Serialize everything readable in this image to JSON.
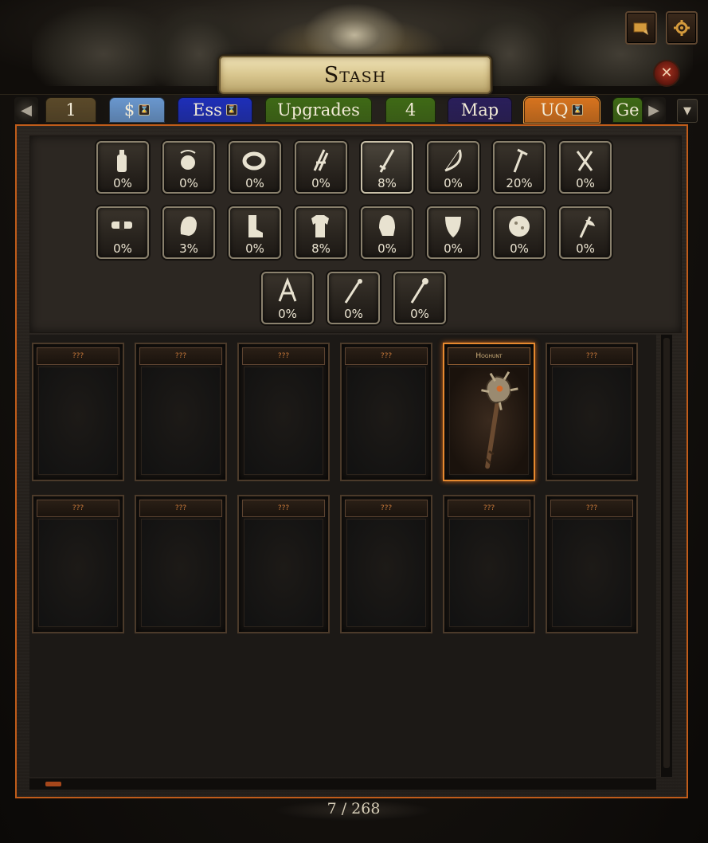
{
  "window": {
    "title": "Stash"
  },
  "header": {
    "close_icon": "close-icon",
    "map_button_icon": "scroll-map-icon",
    "settings_button_icon": "gear-icon"
  },
  "tabs": [
    {
      "label": "1",
      "color": "#5b4a2a",
      "locked": false
    },
    {
      "label": "$",
      "color": "#6a98cf",
      "locked": true
    },
    {
      "label": "Ess",
      "color": "#1e2fb9",
      "locked": true
    },
    {
      "label": "Upgrades",
      "color": "#3f6a16",
      "locked": false
    },
    {
      "label": "4",
      "color": "#3f6a16",
      "locked": false
    },
    {
      "label": "Map",
      "color": "#2a1f5b",
      "locked": false
    },
    {
      "label": "UQ",
      "color": "#d7741f",
      "locked": true,
      "active": true
    },
    {
      "label": "Ge",
      "color": "#3f6a16",
      "locked": false
    }
  ],
  "filters": [
    {
      "icon": "flask-icon",
      "percent": "0%"
    },
    {
      "icon": "amulet-icon",
      "percent": "0%"
    },
    {
      "icon": "ring-icon",
      "percent": "0%"
    },
    {
      "icon": "claw-icon",
      "percent": "0%"
    },
    {
      "icon": "dagger-icon",
      "percent": "8%",
      "active": true
    },
    {
      "icon": "bow-icon",
      "percent": "0%"
    },
    {
      "icon": "wand-icon",
      "percent": "20%"
    },
    {
      "icon": "one-hand-sword-icon",
      "percent": "0%"
    },
    {
      "icon": "belt-icon",
      "percent": "0%"
    },
    {
      "icon": "gloves-icon",
      "percent": "3%"
    },
    {
      "icon": "boots-icon",
      "percent": "0%"
    },
    {
      "icon": "body-armour-icon",
      "percent": "8%"
    },
    {
      "icon": "helmet-icon",
      "percent": "0%"
    },
    {
      "icon": "shield-icon",
      "percent": "0%"
    },
    {
      "icon": "jewel-icon",
      "percent": "0%"
    },
    {
      "icon": "axe-icon",
      "percent": "0%"
    },
    {
      "icon": "two-hand-weapon-icon",
      "percent": "0%"
    },
    {
      "icon": "staff-icon",
      "percent": "0%"
    },
    {
      "icon": "sceptre-icon",
      "percent": "0%"
    }
  ],
  "cards": [
    {
      "name": "???",
      "found": false
    },
    {
      "name": "???",
      "found": false
    },
    {
      "name": "???",
      "found": false
    },
    {
      "name": "???",
      "found": false
    },
    {
      "name": "Hoghunt",
      "found": true
    },
    {
      "name": "???",
      "found": false
    },
    {
      "name": "???",
      "found": false
    },
    {
      "name": "???",
      "found": false
    },
    {
      "name": "???",
      "found": false
    },
    {
      "name": "???",
      "found": false
    },
    {
      "name": "???",
      "found": false
    },
    {
      "name": "???",
      "found": false
    }
  ],
  "footer": {
    "counter": "7 / 268"
  }
}
